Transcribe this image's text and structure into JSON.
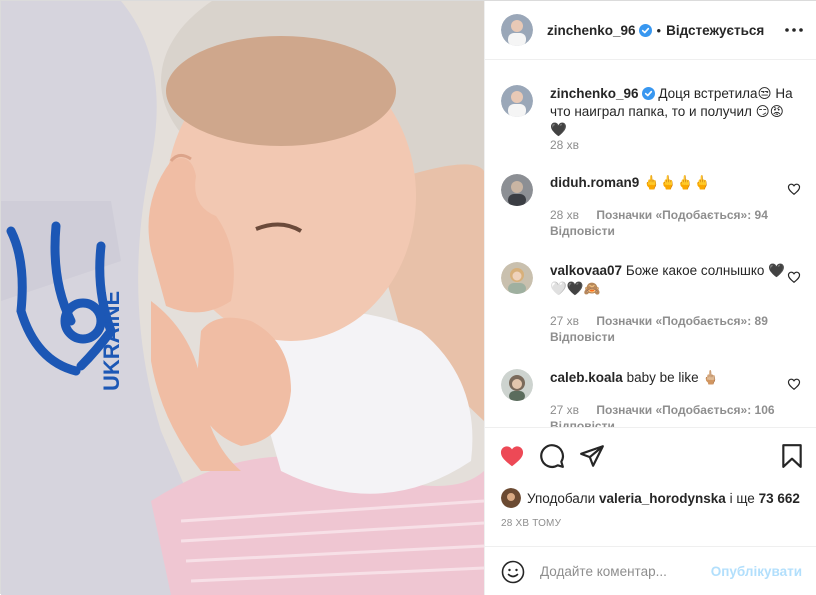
{
  "photo": {
    "description_icon": "photo-image",
    "jersey_text": "UKRAINE"
  },
  "header": {
    "username": "zinchenko_96",
    "verified_icon": "verified-badge-icon",
    "separator": "•",
    "follow_state": "Відстежується",
    "more_icon": "more-options-icon"
  },
  "caption": {
    "username": "zinchenko_96",
    "text": "Доця встретила😒 На что наиграл папка, то и получил 😏😡🖤",
    "time": "28 хв"
  },
  "comments": [
    {
      "username": "diduh.roman9",
      "text": "🖕🖕🖕🖕",
      "time": "28 хв",
      "likes": "Позначки «Подобається»: 94",
      "reply": "Відповісти"
    },
    {
      "username": "valkovaa07",
      "text": "Боже какое солнышко 🖤🤍🖤🙈",
      "time": "27 хв",
      "likes": "Позначки «Подобається»: 89",
      "reply": "Відповісти"
    },
    {
      "username": "caleb.koala",
      "text": "baby be like 🖕🏼",
      "time": "27 хв",
      "likes": "Позначки «Подобається»: 106",
      "reply": "Відповісти"
    }
  ],
  "actions": {
    "like_icon": "heart-filled-icon",
    "comment_icon": "comment-icon",
    "share_icon": "share-icon",
    "save_icon": "bookmark-icon",
    "liked_prefix": "Уподобали",
    "liked_user": "valeria_horodynska",
    "liked_mid": "і ще",
    "liked_count": "73 662",
    "time_ago": "28 ХВ ТОМУ"
  },
  "add_comment": {
    "emoji_icon": "emoji-icon",
    "placeholder": "Додайте коментар...",
    "publish_label": "Опублікувати"
  },
  "colors": {
    "heart": "#ed4956",
    "verified": "#3897f0",
    "publish_disabled": "#b2dffc",
    "muted": "#8e8e8e"
  }
}
